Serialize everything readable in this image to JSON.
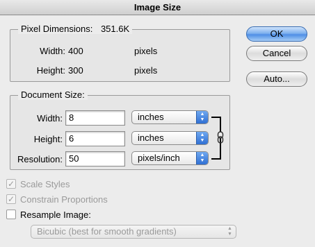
{
  "window": {
    "title": "Image Size"
  },
  "pixel_dimensions": {
    "title": "Pixel Dimensions:",
    "size": "351.6K",
    "width_label": "Width:",
    "width_value": "400",
    "width_unit": "pixels",
    "height_label": "Height:",
    "height_value": "300",
    "height_unit": "pixels"
  },
  "document_size": {
    "title": "Document Size:",
    "width_label": "Width:",
    "width_value": "8",
    "width_unit": "inches",
    "height_label": "Height:",
    "height_value": "6",
    "height_unit": "inches",
    "resolution_label": "Resolution:",
    "resolution_value": "50",
    "resolution_unit": "pixels/inch"
  },
  "options": {
    "scale_styles": {
      "label": "Scale Styles",
      "checked": true,
      "enabled": false
    },
    "constrain_proportions": {
      "label": "Constrain Proportions",
      "checked": true,
      "enabled": false
    },
    "resample_image": {
      "label": "Resample Image:",
      "checked": false,
      "enabled": true
    },
    "resample_method": {
      "value": "Bicubic (best for smooth gradients)",
      "enabled": false
    }
  },
  "buttons": {
    "ok": "OK",
    "cancel": "Cancel",
    "auto": "Auto..."
  },
  "icons": {
    "link": "chain-link-icon",
    "checkmark": "✓",
    "popup_arrows": "▲▼"
  },
  "colors": {
    "accent": "#4f8fe6",
    "bracket": "#000000"
  }
}
